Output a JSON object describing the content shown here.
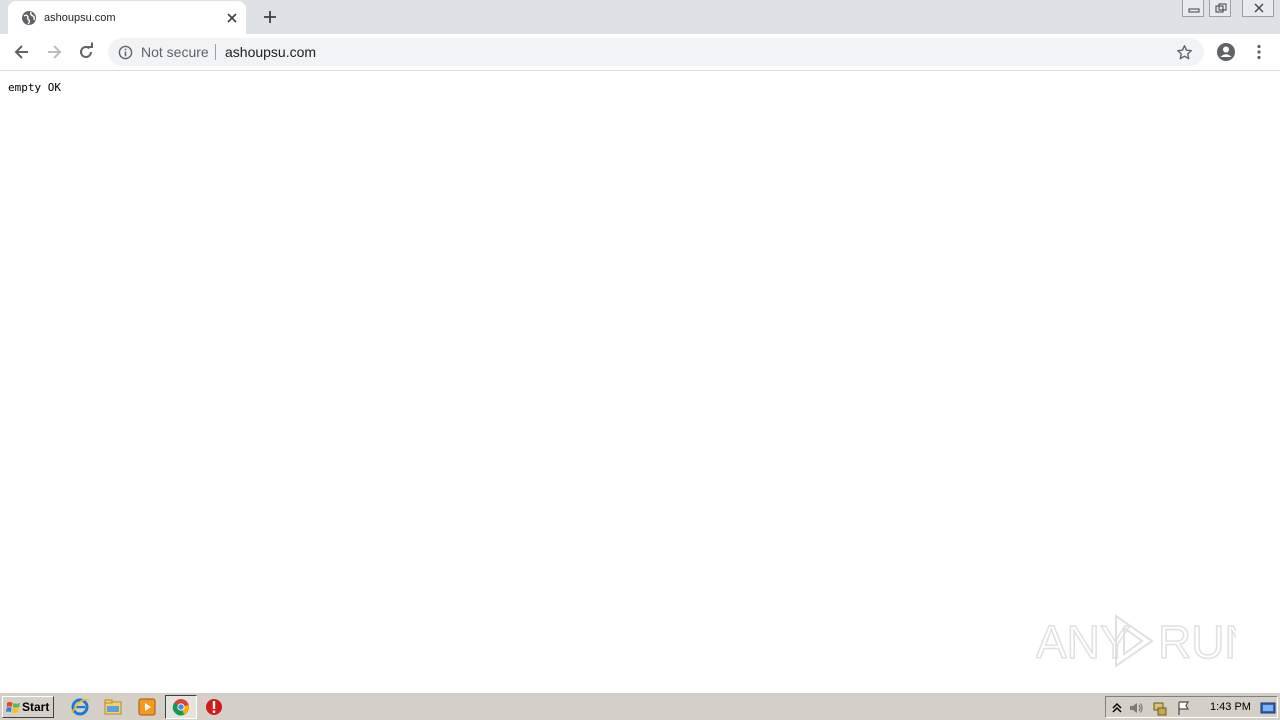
{
  "browser": {
    "tab": {
      "title": "ashoupsu.com",
      "favicon_icon": "globe-icon",
      "close_icon": "close-icon"
    },
    "new_tab_icon": "plus-icon",
    "window_controls": [
      "minimize-icon",
      "restore-icon",
      "close-icon"
    ],
    "toolbar": {
      "back_icon": "back-arrow-icon",
      "forward_icon": "forward-arrow-icon",
      "reload_icon": "reload-icon",
      "security_icon": "info-icon",
      "security_label": "Not secure",
      "url": "ashoupsu.com",
      "bookmark_icon": "star-icon",
      "profile_icon": "account-icon",
      "menu_icon": "kebab-menu-icon"
    }
  },
  "page": {
    "body_text": "empty OK"
  },
  "watermark": {
    "text_left": "ANY",
    "text_right": "RUN"
  },
  "taskbar": {
    "start_label": "Start",
    "pinned": [
      "internet-explorer-icon",
      "folder-icon",
      "media-player-icon",
      "chrome-icon",
      "stop-icon"
    ],
    "active_item": "chrome-icon",
    "tray_icons": [
      "show-hidden-icon",
      "volume-icon",
      "network-icon",
      "action-center-flag-icon",
      "show-desktop-icon"
    ],
    "clock": "1:43 PM"
  },
  "colors": {
    "tabstrip": "#dee1e6",
    "omnibox": "#f1f3f4",
    "taskbar": "#d4d0c8",
    "icon_gray": "#5f6368"
  }
}
